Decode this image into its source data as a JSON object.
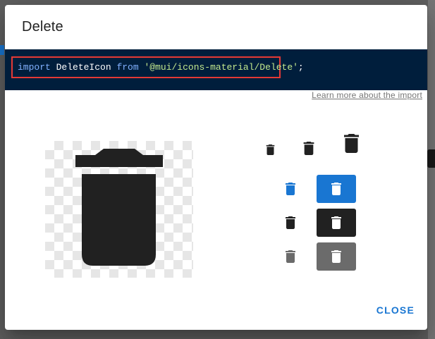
{
  "dialog": {
    "title": "Delete",
    "code": {
      "keyword_import": "import",
      "identifier": "DeleteIcon",
      "keyword_from": "from",
      "module": "'@mui/icons-material/Delete'",
      "semicolon": ";"
    },
    "learn_more": "Learn more about the import",
    "close_label": "CLOSE"
  },
  "icon_name": "delete-icon",
  "colors": {
    "code_background": "#001e3c",
    "highlight_border": "#e53935",
    "primary": "#1976d2",
    "icon_dark": "#212121",
    "icon_disabled": "#6b6b6b",
    "background_page": "#5f5f5f"
  }
}
